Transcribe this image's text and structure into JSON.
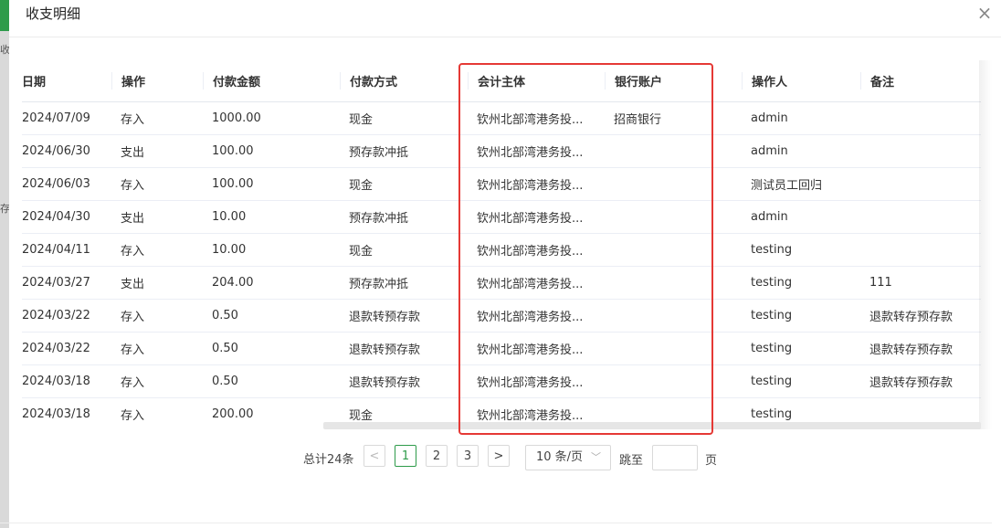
{
  "modal": {
    "title": "收支明细",
    "close_symbol": "×"
  },
  "background": {
    "frag_top": "收款",
    "frag_mid": "存款"
  },
  "table": {
    "columns": [
      "日期",
      "操作",
      "付款金额",
      "付款方式",
      "会计主体",
      "银行账户",
      "",
      "操作人",
      "备注"
    ],
    "rows": [
      [
        "2024/07/09",
        "存入",
        "1000.00",
        "现金",
        "钦州北部湾港务投...",
        "招商银行",
        "",
        "admin",
        ""
      ],
      [
        "2024/06/30",
        "支出",
        "100.00",
        "预存款冲抵",
        "钦州北部湾港务投...",
        "",
        "",
        "admin",
        ""
      ],
      [
        "2024/06/03",
        "存入",
        "100.00",
        "现金",
        "钦州北部湾港务投...",
        "",
        "",
        "测试员工回归",
        ""
      ],
      [
        "2024/04/30",
        "支出",
        "10.00",
        "预存款冲抵",
        "钦州北部湾港务投...",
        "",
        "",
        "admin",
        ""
      ],
      [
        "2024/04/11",
        "存入",
        "10.00",
        "现金",
        "钦州北部湾港务投...",
        "",
        "",
        "testing",
        ""
      ],
      [
        "2024/03/27",
        "支出",
        "204.00",
        "预存款冲抵",
        "钦州北部湾港务投...",
        "",
        "",
        "testing",
        "111"
      ],
      [
        "2024/03/22",
        "存入",
        "0.50",
        "退款转预存款",
        "钦州北部湾港务投...",
        "",
        "",
        "testing",
        "退款转存预存款"
      ],
      [
        "2024/03/22",
        "存入",
        "0.50",
        "退款转预存款",
        "钦州北部湾港务投...",
        "",
        "",
        "testing",
        "退款转存预存款"
      ],
      [
        "2024/03/18",
        "存入",
        "0.50",
        "退款转预存款",
        "钦州北部湾港务投...",
        "",
        "",
        "testing",
        "退款转存预存款"
      ],
      [
        "2024/03/18",
        "存入",
        "200.00",
        "现金",
        "钦州北部湾港务投...",
        "",
        "",
        "testing",
        ""
      ]
    ]
  },
  "pagination": {
    "total": "总计24条",
    "prev": "<",
    "next": ">",
    "pages": [
      "1",
      "2",
      "3"
    ],
    "current": "1",
    "page_size": "10 条/页",
    "chevron": "﹀",
    "jump_label": "跳至",
    "page_label": "页"
  },
  "colors": {
    "accent": "#2e9b4a",
    "highlight": "#e53935"
  }
}
